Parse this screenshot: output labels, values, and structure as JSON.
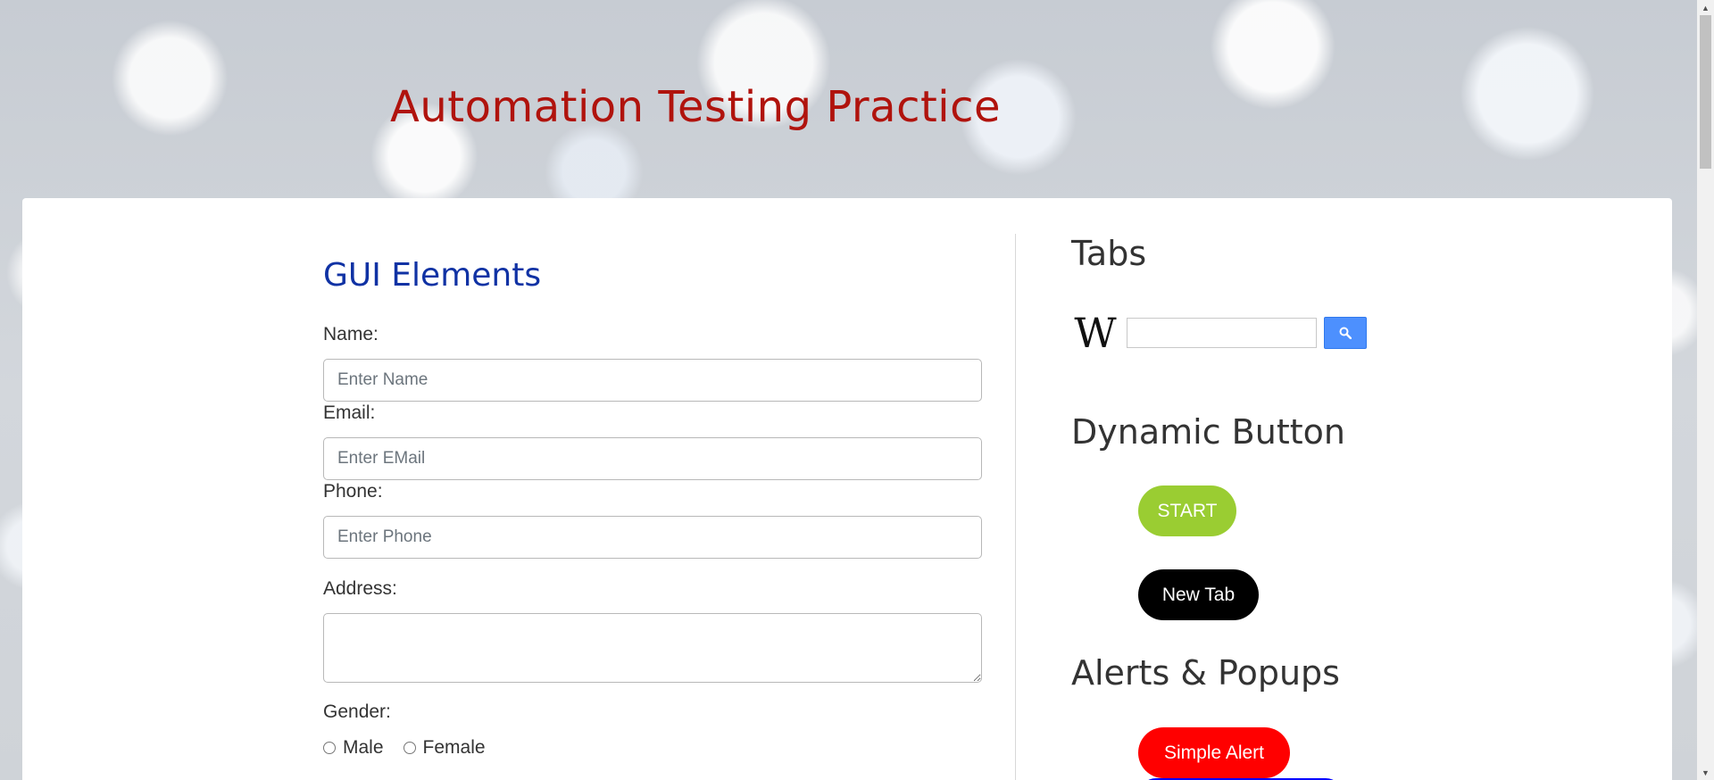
{
  "header": {
    "title": "Automation Testing Practice"
  },
  "gui": {
    "title": "GUI Elements",
    "name_label": "Name:",
    "name_placeholder": "Enter Name",
    "email_label": "Email:",
    "email_placeholder": "Enter EMail",
    "phone_label": "Phone:",
    "phone_placeholder": "Enter Phone",
    "address_label": "Address:",
    "gender_label": "Gender:",
    "gender_options": [
      "Male",
      "Female"
    ]
  },
  "tabs": {
    "title": "Tabs",
    "logo_letter": "W",
    "search_icon": "search-icon"
  },
  "dynamic": {
    "title": "Dynamic Button",
    "start_label": "START",
    "newtab_label": "New Tab"
  },
  "alerts": {
    "title": "Alerts & Popups",
    "simple_alert_label": "Simple Alert"
  },
  "colors": {
    "header_title": "#b0130d",
    "section_title": "#1032a4",
    "start_button": "#9acd32",
    "newtab_button": "#000000",
    "alert_button": "#ff0000",
    "search_button": "#4d90fe"
  }
}
